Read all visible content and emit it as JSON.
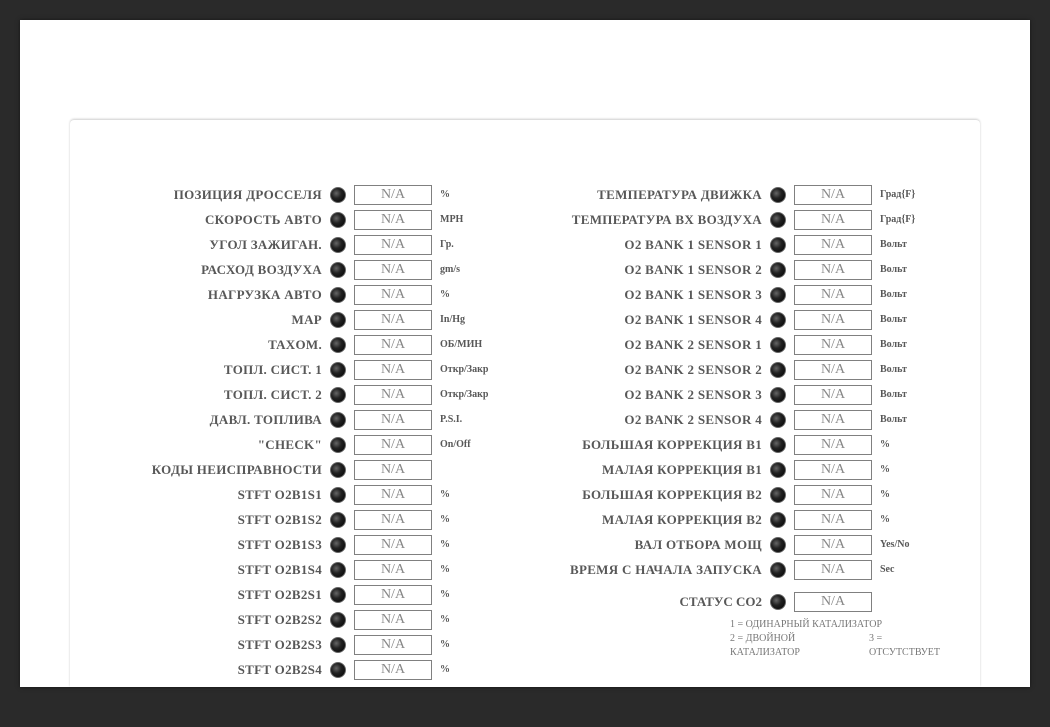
{
  "left": [
    {
      "label": "ПОЗИЦИЯ ДРОССЕЛЯ",
      "value": "N/A",
      "unit": "%"
    },
    {
      "label": "СКОРОСТЬ АВТО",
      "value": "N/A",
      "unit": "MPH"
    },
    {
      "label": "УГОЛ ЗАЖИГАН.",
      "value": "N/A",
      "unit": "Гр."
    },
    {
      "label": "РАСХОД ВОЗДУХА",
      "value": "N/A",
      "unit": "gm/s"
    },
    {
      "label": "НАГРУЗКА  АВТО",
      "value": "N/A",
      "unit": "%"
    },
    {
      "label": "MAP",
      "value": "N/A",
      "unit": "In/Hg"
    },
    {
      "label": "TAXOM.",
      "value": "N/A",
      "unit": "ОБ/МИН"
    },
    {
      "label": "ТОПЛ. СИСТ. 1",
      "value": "N/A",
      "unit": "Откр/Закр"
    },
    {
      "label": "ТОПЛ. СИСТ. 2",
      "value": "N/A",
      "unit": "Откр/Закр"
    },
    {
      "label": "ДАВЛ. ТОПЛИВА",
      "value": "N/A",
      "unit": "P.S.I."
    },
    {
      "label": "\"CHECK\"",
      "value": "N/A",
      "unit": "On/Off"
    },
    {
      "label": "КОДЫ НЕИСПРАВНОСТИ",
      "value": "N/A",
      "unit": ""
    },
    {
      "label": "STFT O2B1S1",
      "value": "N/A",
      "unit": "%"
    },
    {
      "label": "STFT O2B1S2",
      "value": "N/A",
      "unit": "%"
    },
    {
      "label": "STFT O2B1S3",
      "value": "N/A",
      "unit": "%"
    },
    {
      "label": "STFT O2B1S4",
      "value": "N/A",
      "unit": "%"
    },
    {
      "label": "STFT O2B2S1",
      "value": "N/A",
      "unit": "%"
    },
    {
      "label": "STFT O2B2S2",
      "value": "N/A",
      "unit": "%"
    },
    {
      "label": "STFT O2B2S3",
      "value": "N/A",
      "unit": "%"
    },
    {
      "label": "STFT O2B2S4",
      "value": "N/A",
      "unit": "%"
    }
  ],
  "right": [
    {
      "label": "ТЕМПЕРАТУРА ДВИЖКА",
      "value": "N/A",
      "unit": "Град{F}"
    },
    {
      "label": "ТЕМПЕРАТУРА BX ВОЗДУХА",
      "value": "N/A",
      "unit": "Град{F}"
    },
    {
      "label": "O2 BANK 1 SENSOR 1",
      "value": "N/A",
      "unit": "Вольт"
    },
    {
      "label": "O2 BANK 1 SENSOR 2",
      "value": "N/A",
      "unit": "Вольт"
    },
    {
      "label": "O2 BANK 1 SENSOR 3",
      "value": "N/A",
      "unit": "Вольт"
    },
    {
      "label": "O2 BANK 1 SENSOR 4",
      "value": "N/A",
      "unit": "Вольт"
    },
    {
      "label": "O2 BANK 2 SENSOR 1",
      "value": "N/A",
      "unit": "Вольт"
    },
    {
      "label": "O2 BANK 2 SENSOR 2",
      "value": "N/A",
      "unit": "Вольт"
    },
    {
      "label": "O2 BANK 2 SENSOR 3",
      "value": "N/A",
      "unit": "Вольт"
    },
    {
      "label": "O2 BANK 2 SENSOR 4",
      "value": "N/A",
      "unit": "Вольт"
    },
    {
      "label": "БОЛЬШАЯ КОРРЕКЦИЯ B1",
      "value": "N/A",
      "unit": "%"
    },
    {
      "label": "МАЛАЯ КОРРЕКЦИЯ B1",
      "value": "N/A",
      "unit": "%"
    },
    {
      "label": "БОЛЬШАЯ КОРРЕКЦИЯ B2",
      "value": "N/A",
      "unit": "%"
    },
    {
      "label": "МАЛАЯ КОРРЕКЦИЯ B2",
      "value": "N/A",
      "unit": "%"
    },
    {
      "label": "ВАЛ ОТБОРА МОЩ",
      "value": "N/A",
      "unit": "Yes/No"
    },
    {
      "label": "ВРЕМЯ С НАЧАЛА ЗАПУСКА",
      "value": "N/A",
      "unit": "Sec"
    }
  ],
  "co2": {
    "label": "СТАТУС CO2",
    "value": "N/A"
  },
  "legend": {
    "l1": "1 = ОДИНАРНЫЙ КАТАЛИЗАТОР",
    "l2a": "2 = ДВОЙНОЙ КАТАЛИЗАТОР",
    "l2b": "3 = ОТСУТСТВУЕТ"
  }
}
